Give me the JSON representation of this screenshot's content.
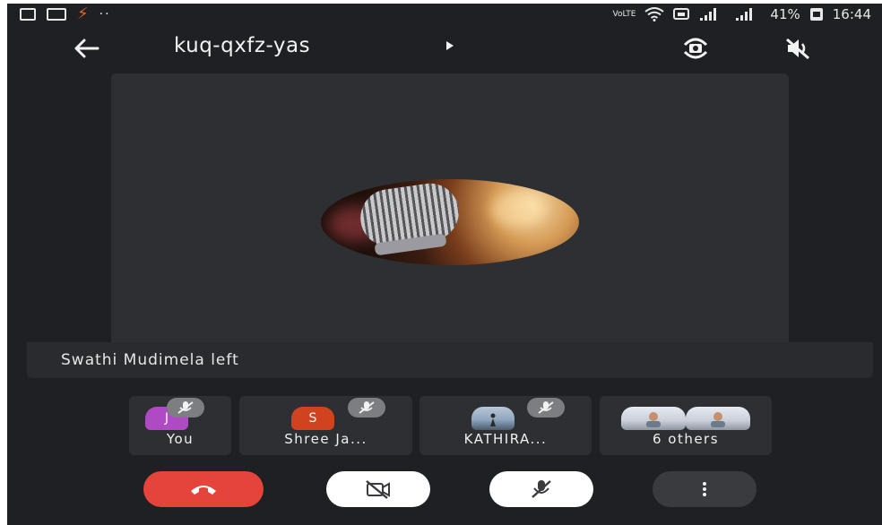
{
  "status_bar": {
    "left_icons": [
      "gallery-icon",
      "card-icon",
      "bolt-icon",
      "more-dots-icon"
    ],
    "network_label": "VoLTE",
    "battery": "41%",
    "time": "16:44"
  },
  "header": {
    "meeting_code": "kuq-qxfz-yas"
  },
  "notice": {
    "text": "Swathi Mudimela left"
  },
  "participants": [
    {
      "label": "You",
      "initial": "J",
      "avatar_color": "#b04ac4"
    },
    {
      "label": "Shree Ja...",
      "initial": "S",
      "avatar_color": "#d1431f"
    },
    {
      "label": "KATHIRA...",
      "initial": "",
      "avatar_color": "#8fa7bf"
    },
    {
      "label": "6 others",
      "initial": "",
      "avatar_color": "#c9cfd8"
    }
  ],
  "controls": {
    "end_call_color": "#e4443a",
    "control_bg": "#ffffff",
    "more_bg": "#3a3b3f"
  }
}
